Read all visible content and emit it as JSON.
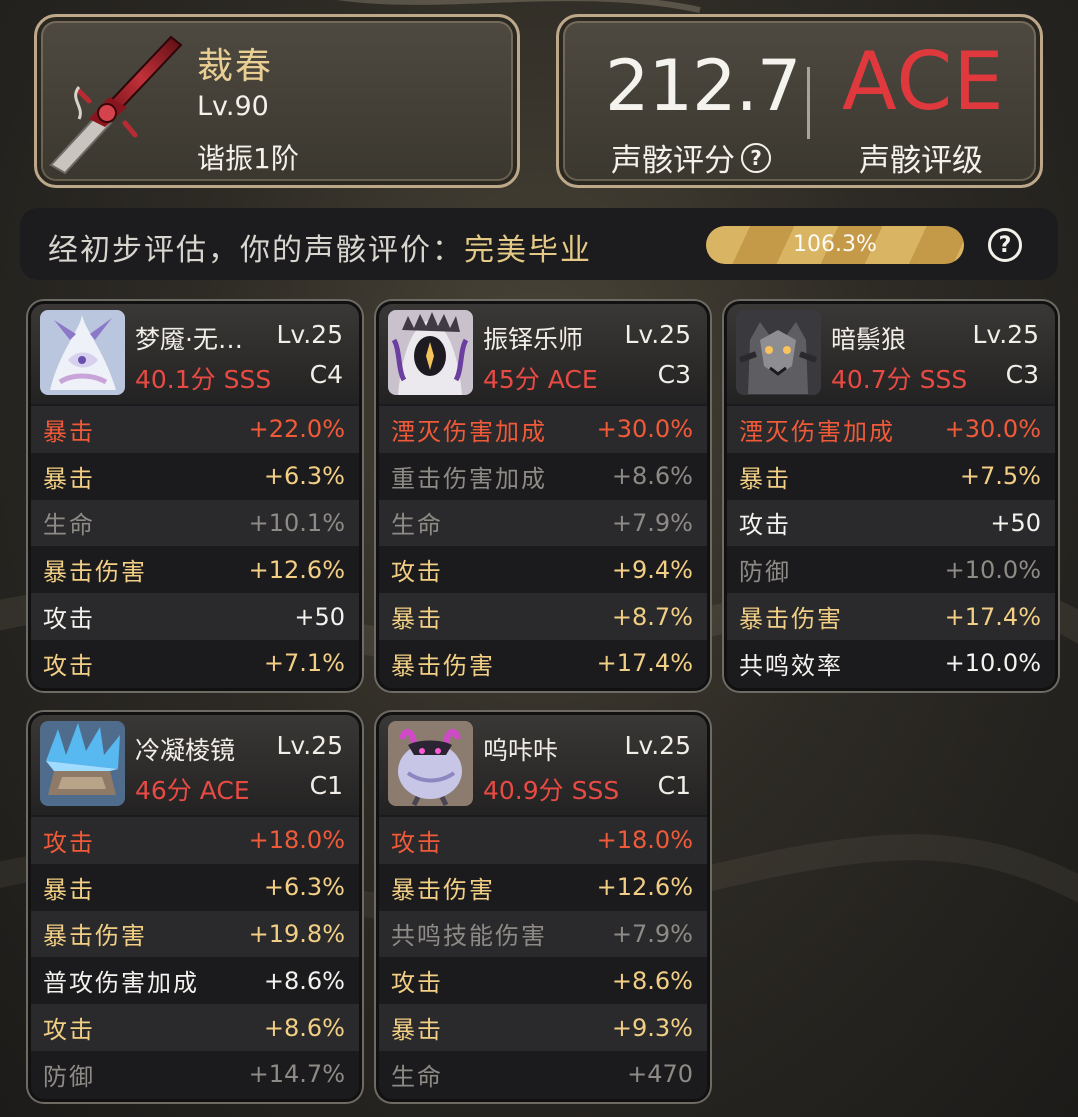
{
  "weapon": {
    "name": "裁春",
    "level": "Lv.90",
    "rank": "谐振1阶",
    "icon": "crimson-sword-icon"
  },
  "score": {
    "value": "212.7",
    "label": "声骸评分",
    "grade": "ACE",
    "grade_label": "声骸评级",
    "grade_color": "#e0393d"
  },
  "evaluation": {
    "prefix": "经初步评估，你的声骸评价：",
    "verdict": "完美毕业",
    "progress_label": "106.3%",
    "progress_percent": 106.3
  },
  "colors": {
    "main_stat": "#f05a38",
    "good_substat": "#f2cf84",
    "normal_substat": "#f4f2ee",
    "dim_substat": "#8e8b86",
    "accent_gold": "#e4ca86"
  },
  "echoes": [
    {
      "name": "梦魇·无…",
      "level": "Lv.25",
      "score": "40.1分 SSS",
      "cost": "C4",
      "avatar": "nightmare-dragon-avatar",
      "stats": [
        {
          "name": "暴击",
          "value": "+22.0%",
          "tier": "main"
        },
        {
          "name": "暴击",
          "value": "+6.3%",
          "tier": "good"
        },
        {
          "name": "生命",
          "value": "+10.1%",
          "tier": "dim"
        },
        {
          "name": "暴击伤害",
          "value": "+12.6%",
          "tier": "good"
        },
        {
          "name": "攻击",
          "value": "+50",
          "tier": "norm"
        },
        {
          "name": "攻击",
          "value": "+7.1%",
          "tier": "good"
        }
      ]
    },
    {
      "name": "振铎乐师",
      "level": "Lv.25",
      "score": "45分 ACE",
      "cost": "C3",
      "avatar": "hooded-musician-avatar",
      "stats": [
        {
          "name": "湮灭伤害加成",
          "value": "+30.0%",
          "tier": "main"
        },
        {
          "name": "重击伤害加成",
          "value": "+8.6%",
          "tier": "dim"
        },
        {
          "name": "生命",
          "value": "+7.9%",
          "tier": "dim"
        },
        {
          "name": "攻击",
          "value": "+9.4%",
          "tier": "good"
        },
        {
          "name": "暴击",
          "value": "+8.7%",
          "tier": "good"
        },
        {
          "name": "暴击伤害",
          "value": "+17.4%",
          "tier": "good"
        }
      ]
    },
    {
      "name": "暗鬃狼",
      "level": "Lv.25",
      "score": "40.7分 SSS",
      "cost": "C3",
      "avatar": "dark-wolf-avatar",
      "stats": [
        {
          "name": "湮灭伤害加成",
          "value": "+30.0%",
          "tier": "main"
        },
        {
          "name": "暴击",
          "value": "+7.5%",
          "tier": "good"
        },
        {
          "name": "攻击",
          "value": "+50",
          "tier": "norm"
        },
        {
          "name": "防御",
          "value": "+10.0%",
          "tier": "dim"
        },
        {
          "name": "暴击伤害",
          "value": "+17.4%",
          "tier": "good"
        },
        {
          "name": "共鸣效率",
          "value": "+10.0%",
          "tier": "norm"
        }
      ]
    },
    {
      "name": "冷凝棱镜",
      "level": "Lv.25",
      "score": "46分 ACE",
      "cost": "C1",
      "avatar": "ice-prism-avatar",
      "stats": [
        {
          "name": "攻击",
          "value": "+18.0%",
          "tier": "main"
        },
        {
          "name": "暴击",
          "value": "+6.3%",
          "tier": "good"
        },
        {
          "name": "暴击伤害",
          "value": "+19.8%",
          "tier": "good"
        },
        {
          "name": "普攻伤害加成",
          "value": "+8.6%",
          "tier": "norm"
        },
        {
          "name": "攻击",
          "value": "+8.6%",
          "tier": "good"
        },
        {
          "name": "防御",
          "value": "+14.7%",
          "tier": "dim"
        }
      ]
    },
    {
      "name": "呜咔咔",
      "level": "Lv.25",
      "score": "40.9分 SSS",
      "cost": "C1",
      "avatar": "purple-blob-avatar",
      "stats": [
        {
          "name": "攻击",
          "value": "+18.0%",
          "tier": "main"
        },
        {
          "name": "暴击伤害",
          "value": "+12.6%",
          "tier": "good"
        },
        {
          "name": "共鸣技能伤害",
          "value": "+7.9%",
          "tier": "dim"
        },
        {
          "name": "攻击",
          "value": "+8.6%",
          "tier": "good"
        },
        {
          "name": "暴击",
          "value": "+9.3%",
          "tier": "good"
        },
        {
          "name": "生命",
          "value": "+470",
          "tier": "dim"
        }
      ]
    }
  ]
}
